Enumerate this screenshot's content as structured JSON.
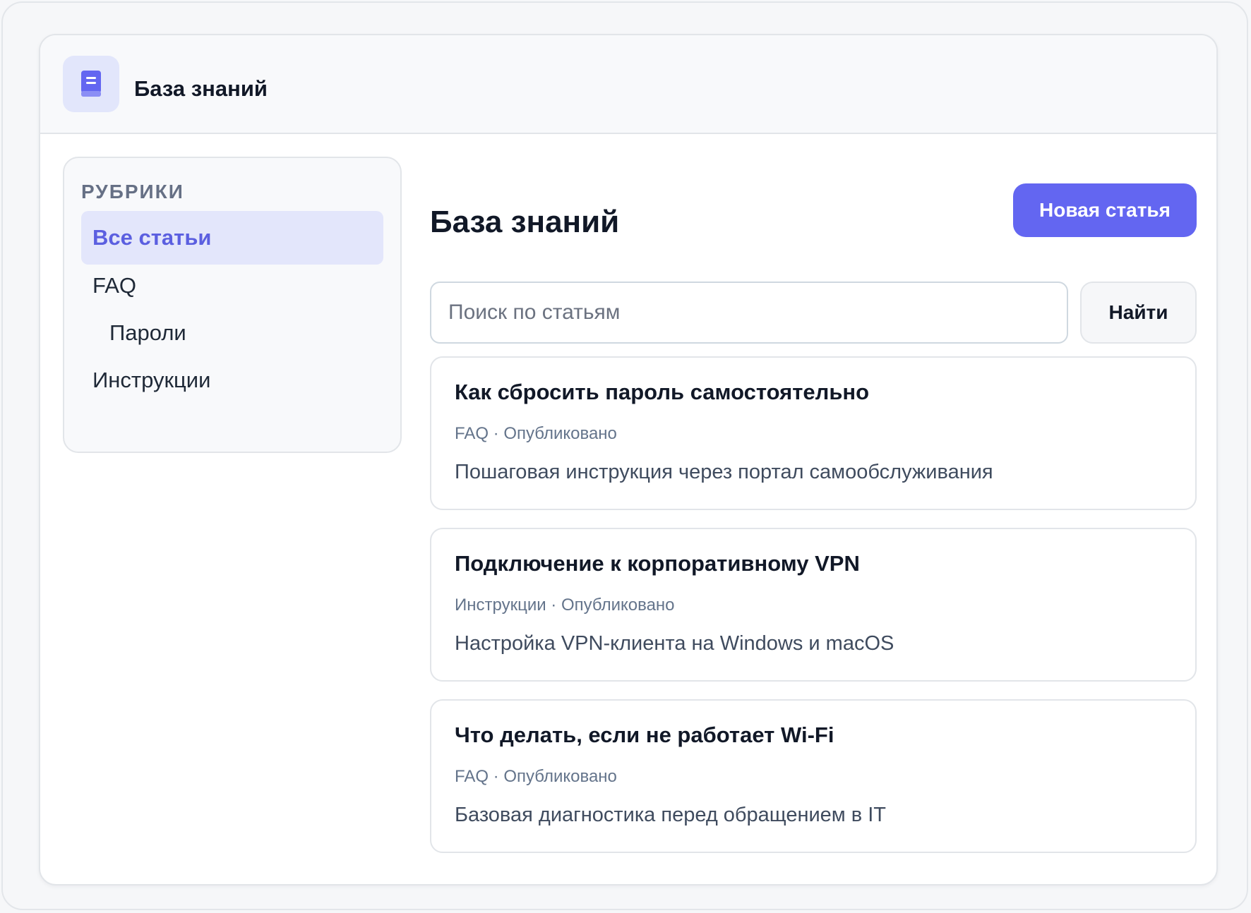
{
  "app": {
    "title": "База знаний",
    "icon": "book-icon",
    "accent": "#6366f1"
  },
  "sidebar": {
    "heading": "РУБРИКИ",
    "items": [
      {
        "label": "Все статьи",
        "active": true
      },
      {
        "label": "FAQ",
        "active": false
      },
      {
        "label": "Пароли",
        "active": false,
        "sub": true
      },
      {
        "label": "Инструкции",
        "active": false
      }
    ]
  },
  "main": {
    "title": "База знаний",
    "new_button": "Новая статья",
    "search": {
      "placeholder": "Поиск по статьям",
      "value": "",
      "button": "Найти"
    },
    "articles": [
      {
        "title": "Как сбросить пароль самостоятельно",
        "meta": "FAQ · Опубликовано",
        "description": "Пошаговая инструкция через портал самообслуживания"
      },
      {
        "title": "Подключение к корпоративному VPN",
        "meta": "Инструкции · Опубликовано",
        "description": "Настройка VPN-клиента на Windows и macOS"
      },
      {
        "title": "Что делать, если не работает Wi-Fi",
        "meta": "FAQ · Опубликовано",
        "description": "Базовая диагностика перед обращением в IT"
      }
    ]
  }
}
